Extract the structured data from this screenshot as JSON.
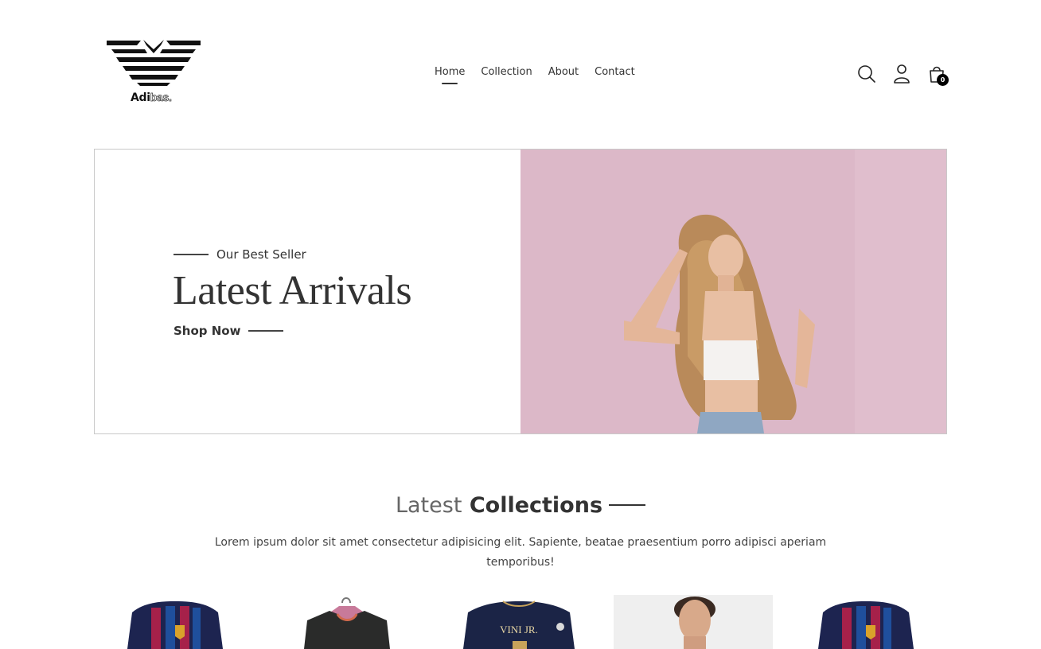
{
  "brand": {
    "name_bold": "Adi",
    "name_outline": "bas."
  },
  "nav": {
    "items": [
      {
        "label": "Home",
        "active": true
      },
      {
        "label": "Collection",
        "active": false
      },
      {
        "label": "About",
        "active": false
      },
      {
        "label": "Contact",
        "active": false
      }
    ]
  },
  "header_icons": {
    "search": "search-icon",
    "profile": "user-icon",
    "cart": "shopping-bag-icon",
    "cart_count": "0"
  },
  "hero": {
    "eyebrow": "Our Best Seller",
    "title": "Latest Arrivals",
    "cta": "Shop Now",
    "image_bg": "#dcb8c8"
  },
  "collections": {
    "title_light": "Latest",
    "title_bold": "Collections",
    "description": "Lorem ipsum dolor sit amet consectetur adipisicing elit. Sapiente, beatae praesentium porro adipisci aperiam temporibus!",
    "products": [
      {
        "name": "barcelona-jersey"
      },
      {
        "name": "black-jersey-on-hanger"
      },
      {
        "name": "vini-jr-jersey",
        "print": "VINI JR."
      },
      {
        "name": "model-portrait"
      },
      {
        "name": "barcelona-jersey"
      }
    ]
  },
  "colors": {
    "text": "#333333",
    "hero_bg": "#dcb8c8",
    "badge": "#000000"
  }
}
